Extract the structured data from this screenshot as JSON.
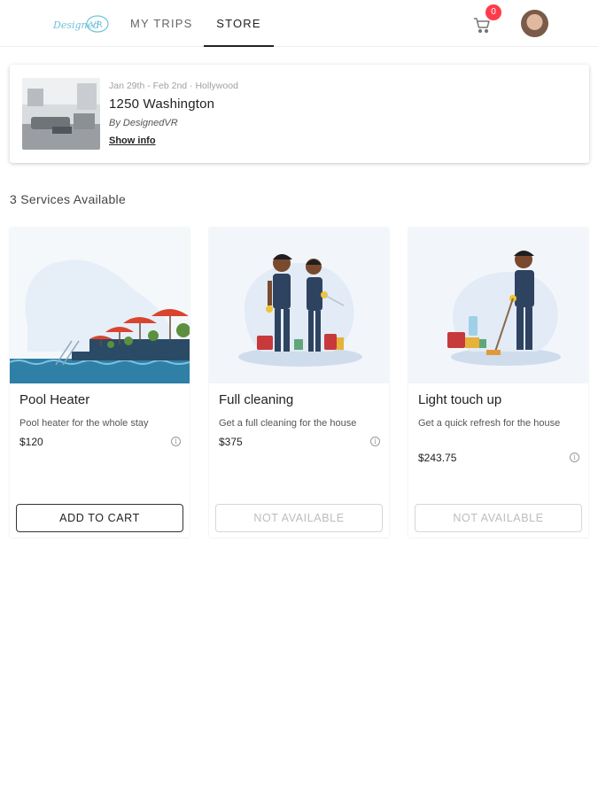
{
  "header": {
    "logo_text": "DesignedVR",
    "tabs": [
      {
        "label": "MY TRIPS"
      },
      {
        "label": "STORE"
      }
    ],
    "cart_count": "0"
  },
  "trip": {
    "dates": "Jan 29th - Feb 2nd · Hollywood",
    "title": "1250 Washington",
    "by": "By DesignedVR",
    "show_info": "Show info"
  },
  "services_count": "3 Services Available",
  "services": [
    {
      "name": "Pool Heater",
      "description": "Pool heater for the whole stay",
      "price": "$120",
      "button": "ADD TO CART",
      "available": true
    },
    {
      "name": "Full cleaning",
      "description": "Get a full cleaning for the house",
      "price": "$375",
      "button": "NOT AVAILABLE",
      "available": false
    },
    {
      "name": "Light touch up",
      "description": "Get a quick refresh for the house",
      "price": "$243.75",
      "button": "NOT AVAILABLE",
      "available": false
    }
  ],
  "colors": {
    "badge": "#ff3b4a",
    "primary_text": "#222222",
    "disabled_text": "#bdbdbd"
  }
}
